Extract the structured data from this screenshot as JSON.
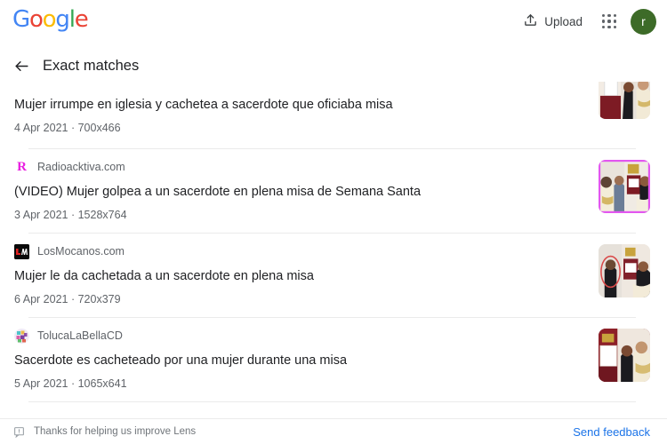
{
  "header": {
    "logo_text": "Google",
    "logo_colors": [
      "#4285F4",
      "#EA4335",
      "#FBBC05",
      "#4285F4",
      "#34A853",
      "#EA4335"
    ],
    "upload_label": "Upload",
    "upload_icon": "upload-icon",
    "apps_icon": "apps-grid-icon",
    "avatar_initial": "r",
    "avatar_color": "#3d6b28"
  },
  "subheader": {
    "back_icon": "back-arrow-icon",
    "title": "Exact matches"
  },
  "results": [
    {
      "source": "",
      "title": "Mujer irrumpe en iglesia y cachetea a sacerdote que oficiaba misa",
      "date": "4 Apr 2021",
      "dimensions": "700x466",
      "separator": "·",
      "clipped": true,
      "favicon_color": "#1a3a6b",
      "thumb_border": "none"
    },
    {
      "source": "Radioacktiva.com",
      "title": "(VIDEO) Mujer golpea a un sacerdote en plena misa de Semana Santa",
      "date": "3 Apr 2021",
      "dimensions": "1528x764",
      "separator": "·",
      "clipped": false,
      "favicon_color": "#e91ee0",
      "favicon_letter": "R",
      "thumb_border": "#e256f0"
    },
    {
      "source": "LosMocanos.com",
      "title": "Mujer le da cachetada a un sacerdote en plena misa",
      "date": "6 Apr 2021",
      "dimensions": "720x379",
      "separator": "·",
      "clipped": false,
      "favicon_color": "#0a0a0a",
      "favicon_letter": "LM",
      "thumb_border": "none"
    },
    {
      "source": "TolucaLaBellaCD",
      "title": "Sacerdote es cacheteado por una mujer durante una misa",
      "date": "5 Apr 2021",
      "dimensions": "1065x641",
      "separator": "·",
      "clipped": false,
      "favicon_color": "#c06bd0",
      "thumb_border": "none"
    }
  ],
  "footer": {
    "feedback_icon": "feedback-icon",
    "thanks_text": "Thanks for helping us improve Lens",
    "send_feedback_label": "Send feedback",
    "link_color": "#1a73e8"
  }
}
